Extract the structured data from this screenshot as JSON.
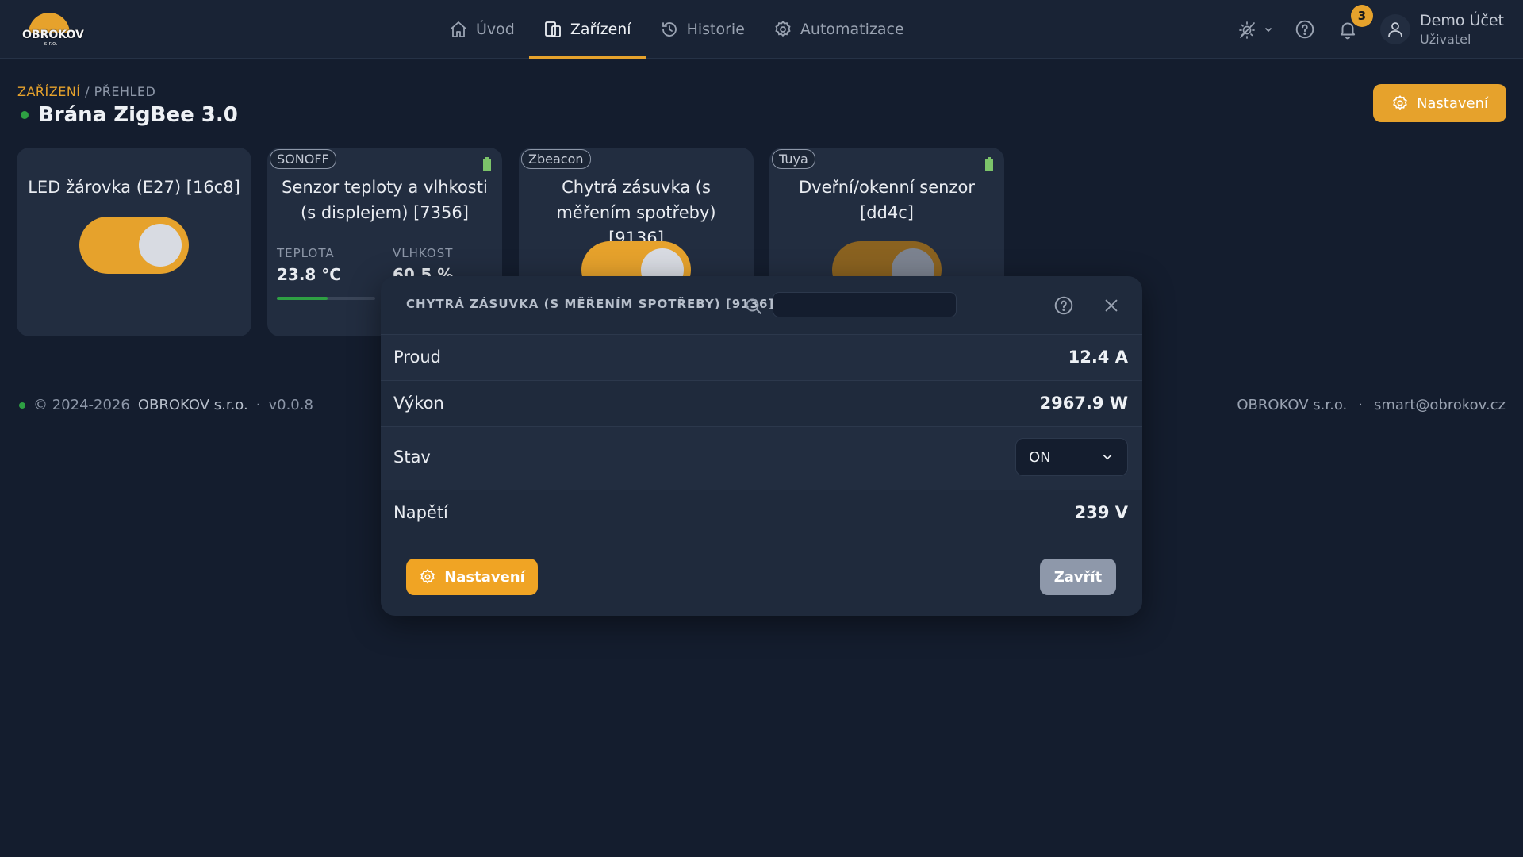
{
  "brand": {
    "logo_text": "OBROKOV",
    "logo_sub": "s.r.o."
  },
  "nav": {
    "items": [
      {
        "label": "Úvod",
        "icon": "home-icon"
      },
      {
        "label": "Zařízení",
        "icon": "devices-icon",
        "active": true
      },
      {
        "label": "Historie",
        "icon": "history-icon"
      },
      {
        "label": "Automatizace",
        "icon": "gear-icon"
      }
    ]
  },
  "topbar": {
    "notification_count": "3",
    "user_name": "Demo Účet",
    "user_role": "Uživatel"
  },
  "breadcrumb": {
    "parent": "ZAŘÍZENÍ",
    "separator": "/",
    "current": "PŘEHLED"
  },
  "page": {
    "title": "Brána ZigBee 3.0",
    "settings_label": "Nastavení"
  },
  "cards": [
    {
      "title": "LED žárovka (E27) [16c8]",
      "toggle_on": true
    },
    {
      "tag": "SONOFF",
      "title": "Senzor teploty a vlhkosti (s displejem) [7356]",
      "stats": [
        {
          "label": "TEPLOTA",
          "value": "23.8 °C"
        },
        {
          "label": "VLHKOST",
          "value": "60.5 %"
        }
      ],
      "progress": 0.52
    },
    {
      "tag": "Zbeacon",
      "title": "Chytrá zásuvka (s měřením spotřeby) [9136]",
      "toggle_on": true
    },
    {
      "tag": "Tuya",
      "title": "Dveřní/okenní senzor [dd4c]",
      "toggle_on": false
    }
  ],
  "footer": {
    "copyright": "© 2024-2026",
    "company": "OBROKOV s.r.o.",
    "separator": "·",
    "version": "v0.0.8",
    "right_company": "OBROKOV s.r.o.",
    "email": "smart@obrokov.cz"
  },
  "modal": {
    "title": "CHYTRÁ ZÁSUVKA (S MĚŘENÍM SPOTŘEBY) [9136]",
    "search_value": "",
    "rows": [
      {
        "label": "Proud",
        "value": "12.4 A"
      },
      {
        "label": "Výkon",
        "value": "2967.9 W"
      },
      {
        "label": "Stav",
        "value": "ON"
      },
      {
        "label": "Napětí",
        "value": "239 V"
      }
    ],
    "settings_label": "Nastavení",
    "close_label": "Zavřít"
  },
  "colors": {
    "accent": "#e6a22c",
    "status_ok": "#2ea043",
    "background": "#141d2e"
  }
}
